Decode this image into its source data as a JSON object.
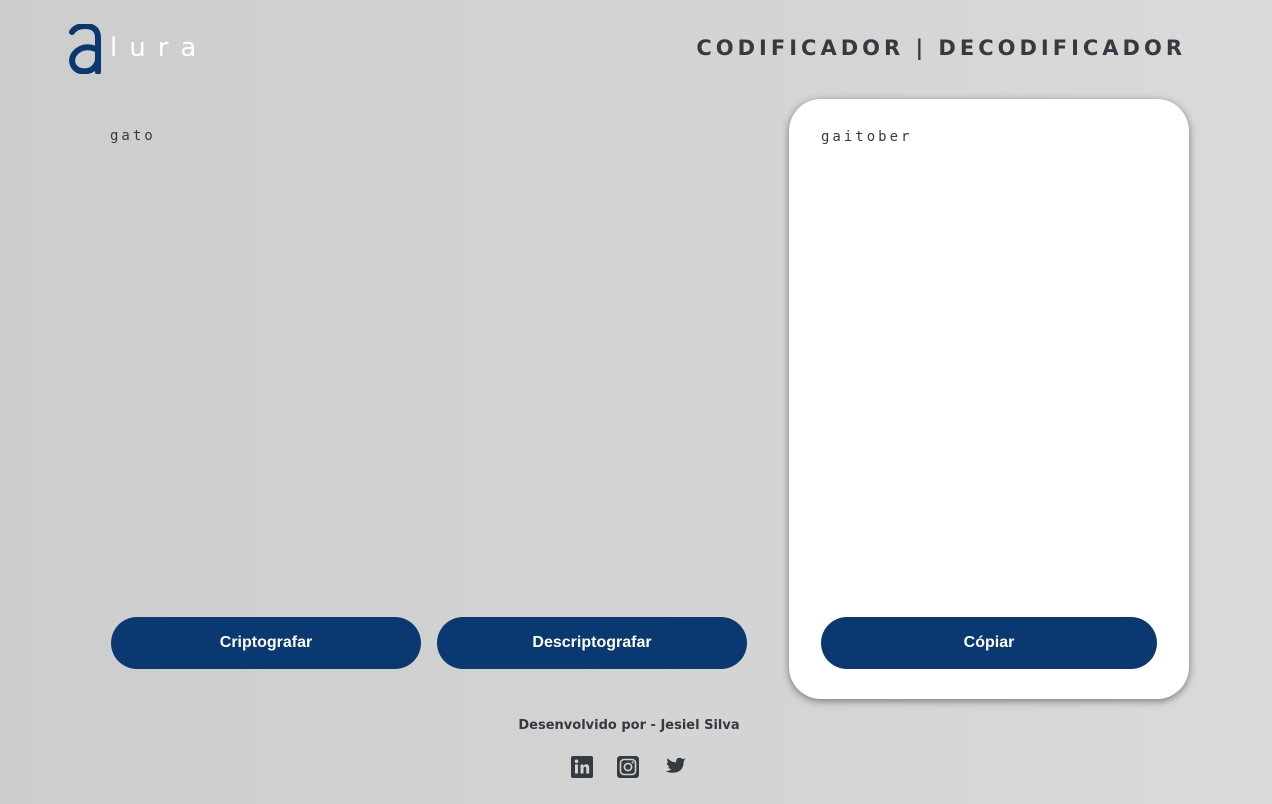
{
  "header": {
    "logo_text": "lura",
    "title": "CODIFICADOR | DECODIFICADOR"
  },
  "input": {
    "value": "gato"
  },
  "buttons": {
    "encrypt_label": "Criptografar",
    "decrypt_label": "Descriptografar",
    "copy_label": "Cópiar"
  },
  "output": {
    "text": "gaitober"
  },
  "footer": {
    "credit": "Desenvolvido por - Jesiel Silva",
    "social_icons": [
      "linkedin-icon",
      "instagram-icon",
      "twitter-icon"
    ]
  },
  "colors": {
    "primary": "#0a3871",
    "text": "#343a40",
    "card": "#ffffff"
  }
}
